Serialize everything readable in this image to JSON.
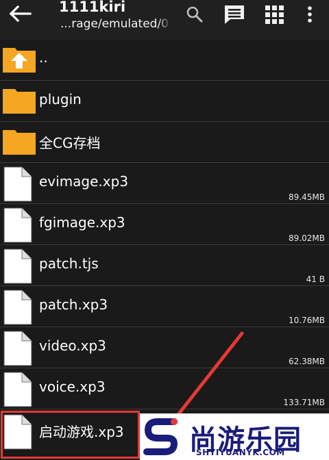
{
  "toolbar": {
    "title": "1111kiri",
    "subtitle": "...rage/emulated/0"
  },
  "files": [
    {
      "name": "..",
      "type": "parent-folder",
      "size": ""
    },
    {
      "name": "plugin",
      "type": "folder",
      "size": ""
    },
    {
      "name": "全CG存档",
      "type": "folder",
      "size": ""
    },
    {
      "name": "evimage.xp3",
      "type": "file",
      "size": "89.45MB"
    },
    {
      "name": "fgimage.xp3",
      "type": "file",
      "size": "89.02MB"
    },
    {
      "name": "patch.tjs",
      "type": "file",
      "size": "41 B"
    },
    {
      "name": "patch.xp3",
      "type": "file",
      "size": "10.76MB"
    },
    {
      "name": "video.xp3",
      "type": "file",
      "size": "62.38MB"
    },
    {
      "name": "voice.xp3",
      "type": "file",
      "size": "133.71MB"
    },
    {
      "name": "启动游戏.xp3",
      "type": "file",
      "size": ""
    }
  ],
  "watermark": {
    "text": "尚游乐园",
    "url": "SHYIYUANYK.COM"
  },
  "colors": {
    "toolbar_bg": "#202020",
    "list_bg": "#1a1a1a",
    "folder": "#f5a623",
    "highlight": "#e53935",
    "watermark_text": "#1a1c7a"
  },
  "icons": [
    "back-arrow-icon",
    "search-icon",
    "comment-icon",
    "grid-view-icon",
    "more-vert-icon",
    "folder-up-icon",
    "folder-icon",
    "file-icon"
  ]
}
